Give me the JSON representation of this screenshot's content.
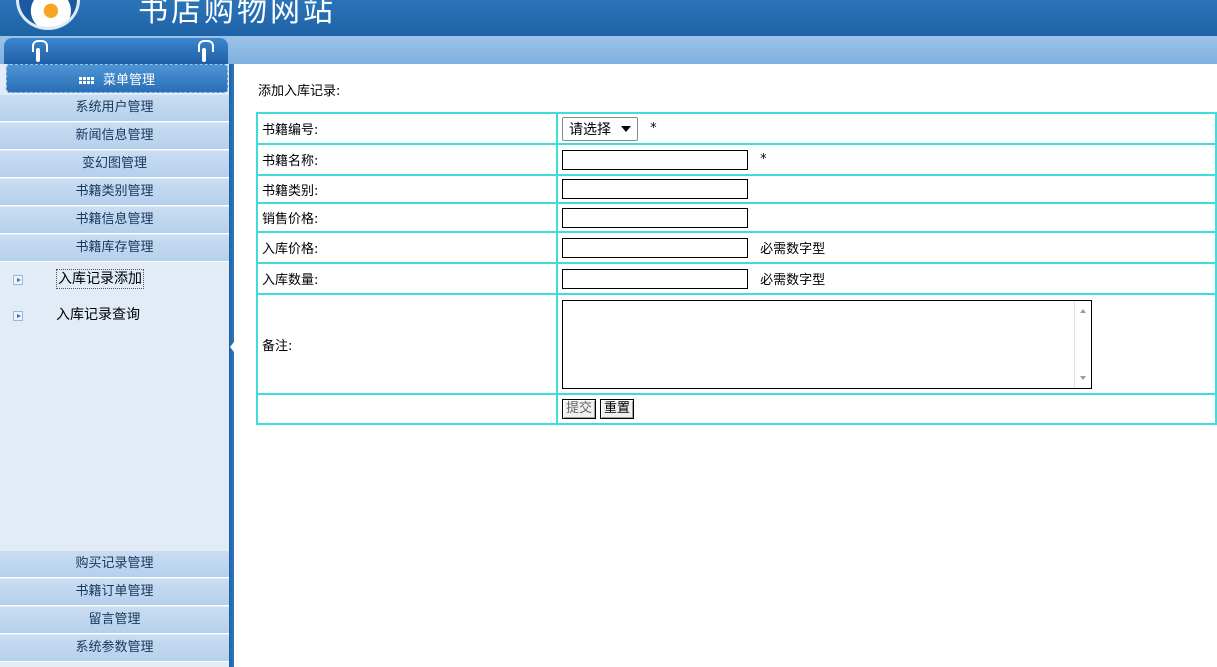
{
  "header": {
    "site_title": "书店购物网站"
  },
  "sidebar": {
    "menu_title": "菜单管理",
    "top_items": [
      {
        "label": "系统用户管理"
      },
      {
        "label": "新闻信息管理"
      },
      {
        "label": "变幻图管理"
      },
      {
        "label": "书籍类别管理"
      },
      {
        "label": "书籍信息管理"
      },
      {
        "label": "书籍库存管理"
      }
    ],
    "sub_items": [
      {
        "label": "入库记录添加",
        "active": true
      },
      {
        "label": "入库记录查询",
        "active": false
      }
    ],
    "bottom_items": [
      {
        "label": "购买记录管理"
      },
      {
        "label": "书籍订单管理"
      },
      {
        "label": "留言管理"
      },
      {
        "label": "系统参数管理"
      }
    ]
  },
  "main": {
    "page_title": "添加入库记录:",
    "form": {
      "book_id_label": "书籍编号:",
      "book_id_select": "请选择",
      "book_name_label": "书籍名称:",
      "book_category_label": "书籍类别:",
      "sale_price_label": "销售价格:",
      "stock_price_label": "入库价格:",
      "stock_qty_label": "入库数量:",
      "remark_label": "备注:",
      "required_mark": "*",
      "numeric_hint": "必需数字型",
      "submit_label": "提交",
      "reset_label": "重置"
    }
  },
  "colors": {
    "header_blue": "#2b74b8",
    "sidebar_bg": "#e1ecf7",
    "table_border": "#3fdcdc"
  }
}
